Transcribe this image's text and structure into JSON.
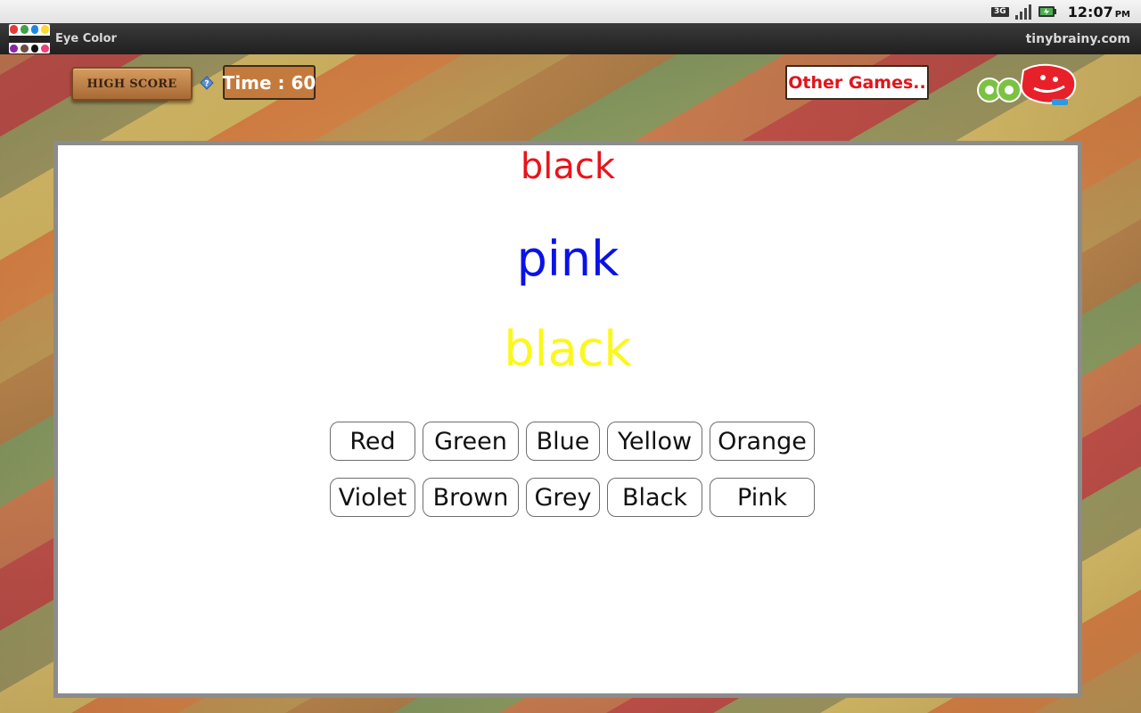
{
  "status_bar": {
    "network_type": "3G",
    "time": "12:07",
    "ampm": "PM",
    "icons": [
      "network-3g-icon",
      "signal-strength-icon",
      "battery-charging-icon"
    ]
  },
  "title_bar": {
    "app_title": "Eye Color",
    "site": "tinybrainy.com",
    "app_icon": "eye-colors-app-icon"
  },
  "toolbar": {
    "high_score_label": "HIGH SCORE",
    "time_label": "Time : 60",
    "other_games_label": "Other Games..",
    "info_icon": "info-icon",
    "logo": "tinybrainy-logo"
  },
  "question": {
    "words": [
      {
        "text": "black",
        "color": "#e8141c"
      },
      {
        "text": "pink",
        "color": "#0a12e6"
      },
      {
        "text": "black",
        "color": "#fbf81a"
      }
    ]
  },
  "answers": {
    "row1": [
      "Red",
      "Green",
      "Blue",
      "Yellow",
      "Orange"
    ],
    "row2": [
      "Violet",
      "Brown",
      "Grey",
      "Black",
      "Pink"
    ]
  },
  "colors": {
    "accent_red": "#e0151c",
    "time_box": "#c47a3c",
    "panel_border": "#8c8c8c"
  }
}
